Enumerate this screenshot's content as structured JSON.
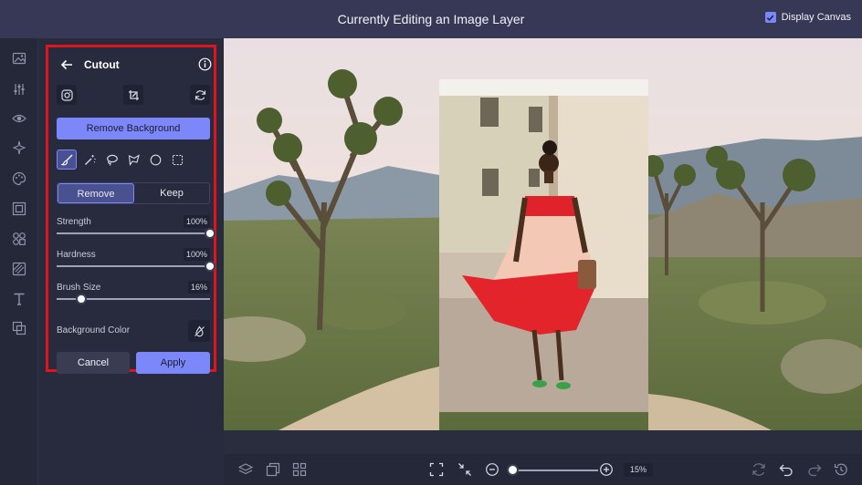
{
  "topbar": {
    "title": "Currently Editing an Image Layer",
    "display_canvas_label": "Display Canvas",
    "display_canvas_checked": true
  },
  "toolrail": {
    "icons": [
      "image-icon",
      "adjustments-icon",
      "eye-icon",
      "effects-icon",
      "palette-icon",
      "frame-icon",
      "shapes-icon",
      "texture-icon",
      "text-icon",
      "layers-graphic-icon"
    ]
  },
  "cutout_panel": {
    "title": "Cutout",
    "remove_background_label": "Remove Background",
    "mode": {
      "remove_label": "Remove",
      "keep_label": "Keep",
      "selected": "Remove"
    },
    "strength": {
      "label": "Strength",
      "value_text": "100%",
      "value": 100
    },
    "hardness": {
      "label": "Hardness",
      "value_text": "100%",
      "value": 100
    },
    "brush_size": {
      "label": "Brush Size",
      "value_text": "16%",
      "value": 16
    },
    "background_color_label": "Background Color",
    "cancel_label": "Cancel",
    "apply_label": "Apply",
    "highlight_color": "#e0141d",
    "accent_color": "#7c87f9"
  },
  "bottombar": {
    "zoom_text": "15%",
    "zoom_value": 15
  }
}
